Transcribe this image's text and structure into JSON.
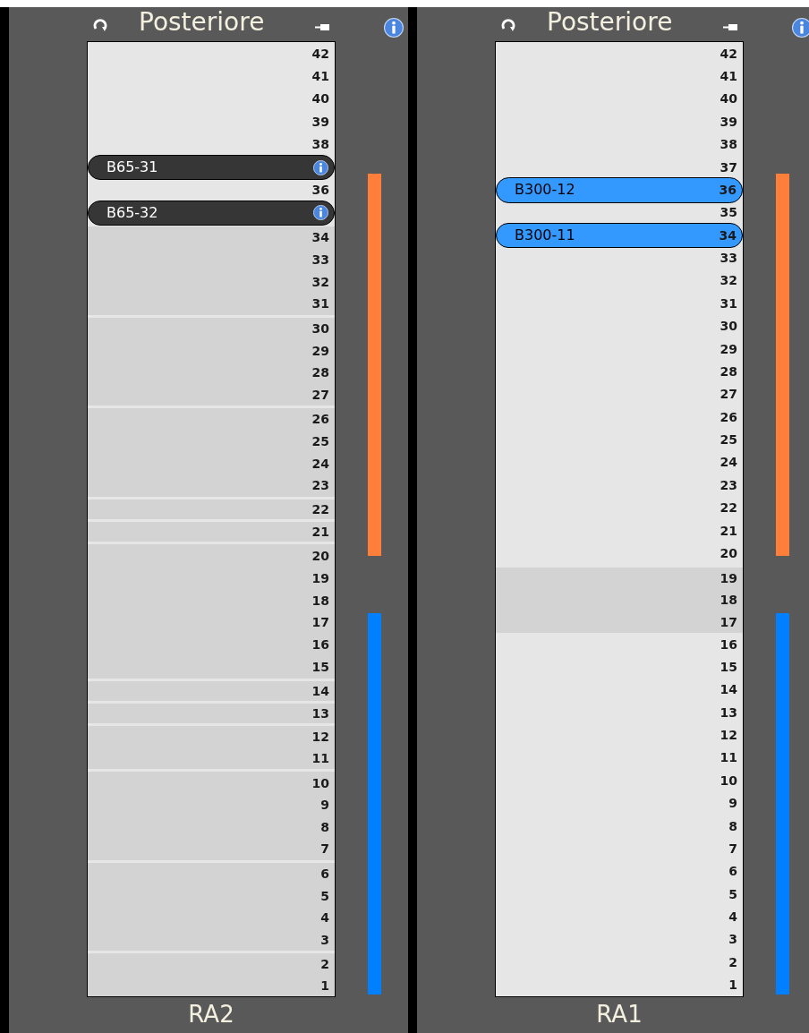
{
  "racks": [
    {
      "title": "Posteriore",
      "label": "RA2",
      "slots": [
        {
          "kind": "empty",
          "units": [
            "42",
            "41",
            "40",
            "39",
            "38"
          ]
        },
        {
          "kind": "device",
          "name": "B65-31",
          "color": "#363636",
          "info": true
        },
        {
          "kind": "empty",
          "units": [
            "36"
          ]
        },
        {
          "kind": "device",
          "name": "B65-32",
          "color": "#363636",
          "info": true
        },
        {
          "kind": "block",
          "units": [
            "34",
            "33",
            "32",
            "31"
          ]
        },
        {
          "kind": "block",
          "units": [
            "30",
            "29",
            "28",
            "27"
          ]
        },
        {
          "kind": "block",
          "units": [
            "26",
            "25",
            "24",
            "23"
          ]
        },
        {
          "kind": "block",
          "units": [
            "22"
          ]
        },
        {
          "kind": "block",
          "units": [
            "21"
          ]
        },
        {
          "kind": "block",
          "units": [
            "20",
            "19",
            "18",
            "17",
            "16",
            "15"
          ]
        },
        {
          "kind": "block",
          "units": [
            "14"
          ]
        },
        {
          "kind": "block",
          "units": [
            "13"
          ]
        },
        {
          "kind": "block",
          "units": [
            "12",
            "11"
          ]
        },
        {
          "kind": "block",
          "units": [
            "10",
            "9",
            "8",
            "7"
          ]
        },
        {
          "kind": "block",
          "units": [
            "6",
            "5",
            "4",
            "3"
          ]
        },
        {
          "kind": "block",
          "units": [
            "2",
            "1"
          ]
        }
      ]
    },
    {
      "title": "Posteriore",
      "label": "RA1",
      "slots": [
        {
          "kind": "empty",
          "units": [
            "42",
            "41",
            "40",
            "39",
            "38",
            "37"
          ]
        },
        {
          "kind": "device",
          "name": "B300-12",
          "color": "#3399ff",
          "info": false,
          "units": [
            "36"
          ]
        },
        {
          "kind": "empty",
          "units": [
            "35"
          ]
        },
        {
          "kind": "device",
          "name": "B300-11",
          "color": "#3399ff",
          "info": false,
          "units": [
            "34"
          ]
        },
        {
          "kind": "empty",
          "units": [
            "33",
            "32",
            "31",
            "30",
            "29",
            "28",
            "27",
            "26",
            "25",
            "24",
            "23",
            "22",
            "21",
            "20"
          ]
        },
        {
          "kind": "block",
          "units": [
            "19",
            "18",
            "17"
          ]
        },
        {
          "kind": "empty",
          "units": [
            "16",
            "15",
            "14",
            "13",
            "12",
            "11",
            "10",
            "9",
            "8",
            "7",
            "6",
            "5",
            "4",
            "3",
            "2",
            "1"
          ]
        }
      ]
    }
  ]
}
